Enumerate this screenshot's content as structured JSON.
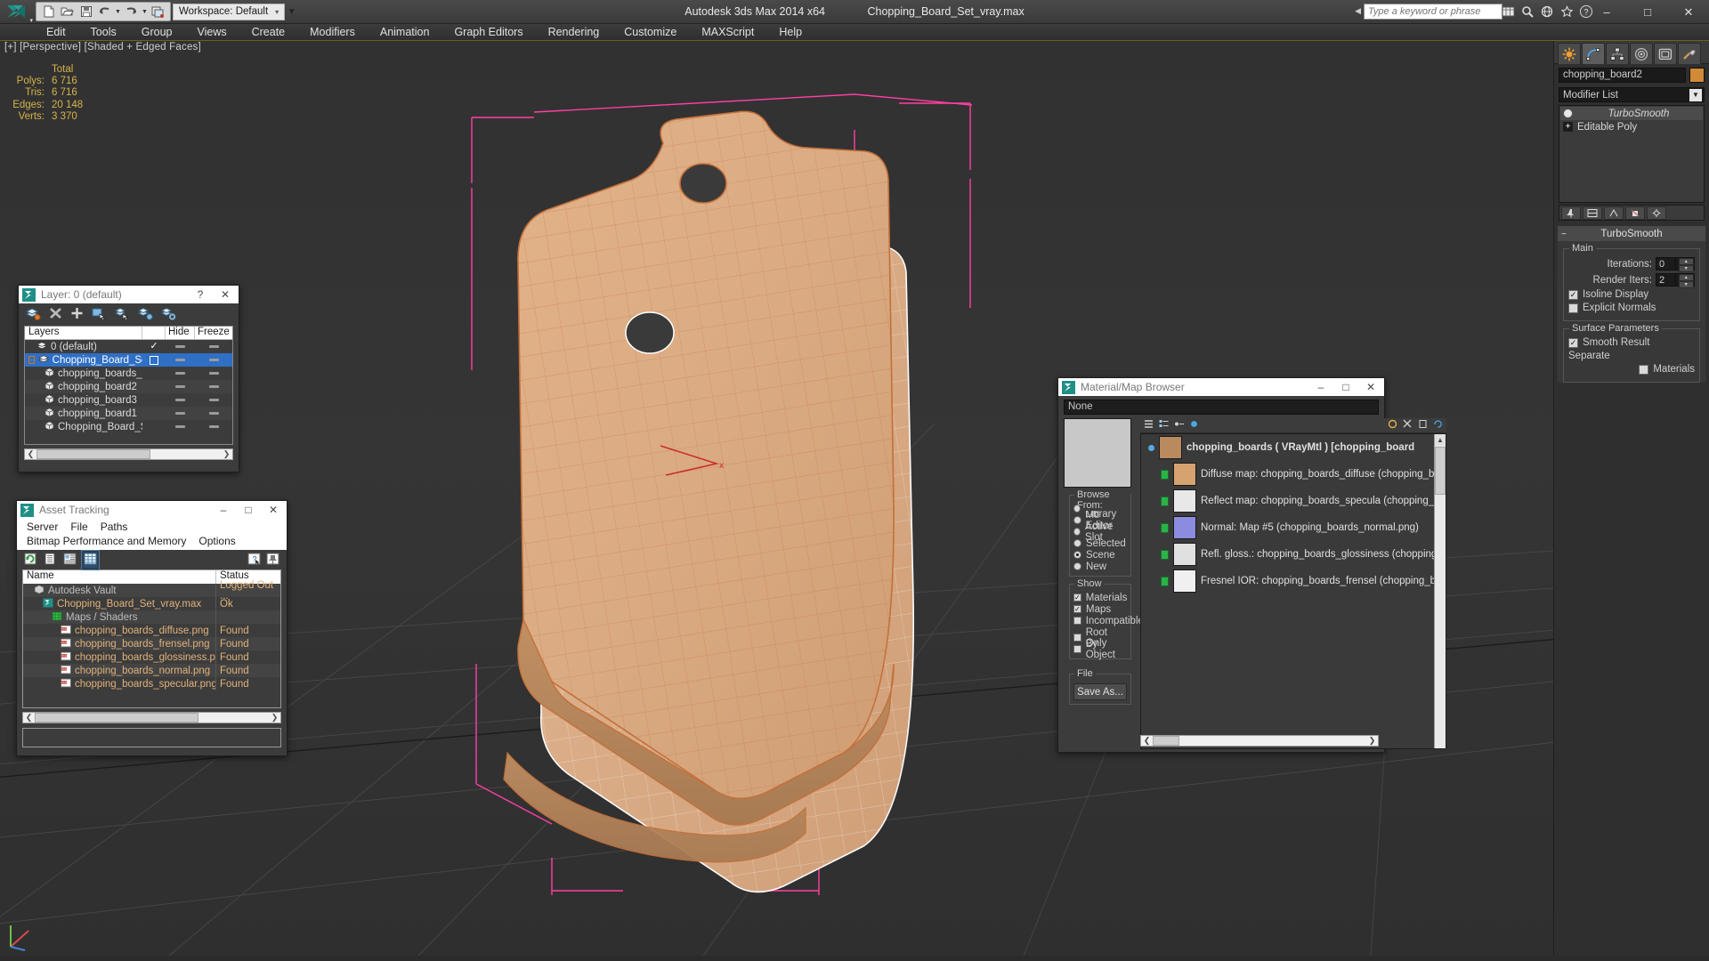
{
  "titlebar": {
    "app_title": "Autodesk 3ds Max  2014 x64",
    "file_title": "Chopping_Board_Set_vray.max",
    "workspace": "Workspace: Default",
    "search_placeholder": "Type a keyword or phrase",
    "quick_access": [
      "new-icon",
      "open-icon",
      "save-icon",
      "undo-icon",
      "redo-icon",
      "set-project-icon"
    ],
    "right_icons": [
      "sheet-icon",
      "search-icon",
      "help-web-icon",
      "favorites-icon"
    ],
    "help_icon": "question-icon",
    "window_controls": {
      "minimize": "–",
      "maximize": "□",
      "close": "✕"
    }
  },
  "menubar": {
    "items": [
      "Edit",
      "Tools",
      "Group",
      "Views",
      "Create",
      "Modifiers",
      "Animation",
      "Graph Editors",
      "Rendering",
      "Customize",
      "MAXScript",
      "Help"
    ]
  },
  "viewport": {
    "label": "[+] [Perspective] [Shaded + Edged Faces]",
    "stats": {
      "header": "Total",
      "rows": [
        {
          "key": "Polys:",
          "value": "6 716"
        },
        {
          "key": "Tris:",
          "value": "6 716"
        },
        {
          "key": "Edges:",
          "value": "20 148"
        },
        {
          "key": "Verts:",
          "value": "3 370"
        }
      ]
    }
  },
  "command_panel": {
    "tabs": [
      "create-tab",
      "modify-tab",
      "hierarchy-tab",
      "motion-tab",
      "display-tab",
      "utilities-tab"
    ],
    "active_tab_index": 1,
    "object_name": "chopping_board2",
    "object_color": "#d18a36",
    "modifier_list_label": "Modifier List",
    "modifier_stack": [
      {
        "label": "TurboSmooth",
        "active": true
      },
      {
        "label": "Editable Poly",
        "active": false
      }
    ],
    "turbosmooth": {
      "title": "TurboSmooth",
      "main_group": "Main",
      "iterations_label": "Iterations:",
      "iterations_value": "0",
      "render_iters_label": "Render Iters:",
      "render_iters_value": "2",
      "isoline_display": "Isoline Display",
      "isoline_checked": true,
      "explicit_normals": "Explicit Normals",
      "explicit_checked": false,
      "surface_params_group": "Surface Parameters",
      "smooth_result": "Smooth Result",
      "smooth_checked": true,
      "separate_label": "Separate",
      "materials_label": "Materials"
    }
  },
  "layer_dialog": {
    "title": "Layer: 0 (default)",
    "help_glyph": "?",
    "close_glyph": "✕",
    "toolbar": [
      "create-new-layer-icon",
      "delete-layer-icon",
      "add-layer-icon",
      "select-objects-icon",
      "select-highlighted-icon",
      "highlight-selected-icon",
      "layer-properties-icon"
    ],
    "columns": [
      "Layers",
      "",
      "Hide",
      "Freeze"
    ],
    "rows": [
      {
        "name": "0 (default)",
        "indent": 1,
        "icon": "layer-icon",
        "current": true,
        "selected": false,
        "hide": "dash",
        "freeze": "dash",
        "box": false
      },
      {
        "name": "Chopping_Board_Set",
        "indent": 0,
        "icon": "layer-icon",
        "current": false,
        "selected": true,
        "hide": "dash",
        "freeze": "dash",
        "box": true,
        "expander": "−"
      },
      {
        "name": "chopping_boards_stand",
        "indent": 2,
        "icon": "object-icon",
        "hide": "dash",
        "freeze": "dash"
      },
      {
        "name": "chopping_board2",
        "indent": 2,
        "icon": "object-icon",
        "hide": "dash",
        "freeze": "dash"
      },
      {
        "name": "chopping_board3",
        "indent": 2,
        "icon": "object-icon",
        "hide": "dash",
        "freeze": "dash"
      },
      {
        "name": "chopping_board1",
        "indent": 2,
        "icon": "object-icon",
        "hide": "dash",
        "freeze": "dash"
      },
      {
        "name": "Chopping_Board_Set",
        "indent": 2,
        "icon": "object-icon",
        "hide": "dash",
        "freeze": "dash"
      }
    ]
  },
  "asset_dialog": {
    "title": "Asset Tracking",
    "minimize_glyph": "–",
    "maximize_glyph": "□",
    "close_glyph": "✕",
    "menu": [
      "Server",
      "File",
      "Paths",
      "Bitmap Performance and Memory",
      "Options"
    ],
    "toolbar": [
      "refresh-icon",
      "list-view-icon",
      "detail-view-icon",
      "grid-view-icon"
    ],
    "toolbar_right": [
      "help-icon",
      "pin-icon"
    ],
    "columns": [
      "Name",
      "Status"
    ],
    "rows": [
      {
        "name": "Autodesk Vault",
        "status": "Logged Out ...",
        "indent": 1,
        "icon": "vault-icon",
        "grey": true
      },
      {
        "name": "Chopping_Board_Set_vray.max",
        "status": "Ok",
        "indent": 2,
        "icon": "max-file-icon"
      },
      {
        "name": "Maps / Shaders",
        "status": "",
        "indent": 3,
        "icon": "maps-icon",
        "grey": true
      },
      {
        "name": "chopping_boards_diffuse.png",
        "status": "Found",
        "indent": 4,
        "icon": "png-icon"
      },
      {
        "name": "chopping_boards_frensel.png",
        "status": "Found",
        "indent": 4,
        "icon": "png-icon"
      },
      {
        "name": "chopping_boards_glossiness.png",
        "status": "Found",
        "indent": 4,
        "icon": "png-icon"
      },
      {
        "name": "chopping_boards_normal.png",
        "status": "Found",
        "indent": 4,
        "icon": "png-icon"
      },
      {
        "name": "chopping_boards_specular.png",
        "status": "Found",
        "indent": 4,
        "icon": "png-icon"
      }
    ]
  },
  "material_browser": {
    "title": "Material/Map Browser",
    "minimize_glyph": "–",
    "maximize_glyph": "□",
    "close_glyph": "✕",
    "find_value": "None",
    "toolbar": [
      "options-icon",
      "list-view-icon",
      "small-icons-icon",
      "display-icon",
      "material-editor-icon",
      "cut-icon",
      "paste-icon",
      "update-icon"
    ],
    "items": [
      {
        "label": "chopping_boards  ( VRayMtl )  [chopping_board",
        "type": "material",
        "swatch": "#b98a5e",
        "indent": 0,
        "header": true
      },
      {
        "label": "Diffuse map: chopping_boards_diffuse (chopping_bo",
        "type": "map",
        "swatch": "#d6a270",
        "indent": 1
      },
      {
        "label": "Reflect map: chopping_boards_specula (chopping_bo",
        "type": "map",
        "swatch": "#e8e8e8",
        "indent": 1
      },
      {
        "label": "Normal: Map #5 (chopping_boards_normal.png)",
        "type": "map",
        "swatch": "#8b8ce0",
        "indent": 1
      },
      {
        "label": "Refl. gloss.: chopping_boards_glossiness (chopping_",
        "type": "map",
        "swatch": "#e0e0e0",
        "indent": 1
      },
      {
        "label": "Fresnel IOR: chopping_boards_frensel (chopping_bo",
        "type": "map",
        "swatch": "#f0f0f0",
        "indent": 1
      }
    ],
    "browse_from": {
      "label": "Browse From:",
      "options": [
        {
          "label": "Mtl Library",
          "selected": false
        },
        {
          "label": "Mtl Editor",
          "selected": false
        },
        {
          "label": "Active Slot",
          "selected": false
        },
        {
          "label": "Selected",
          "selected": false
        },
        {
          "label": "Scene",
          "selected": true
        },
        {
          "label": "New",
          "selected": false
        }
      ]
    },
    "show": {
      "label": "Show",
      "options": [
        {
          "label": "Materials",
          "checked": true
        },
        {
          "label": "Maps",
          "checked": true
        },
        {
          "label": "Incompatible",
          "checked": false
        },
        {
          "label": "Root Only",
          "checked": false
        },
        {
          "label": "By Object",
          "checked": false
        }
      ]
    },
    "file": {
      "label": "File",
      "save_as": "Save As..."
    }
  }
}
